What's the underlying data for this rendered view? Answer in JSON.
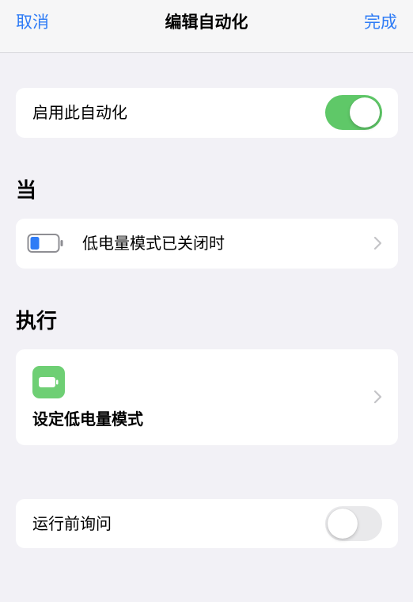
{
  "navbar": {
    "cancel_label": "取消",
    "title": "编辑自动化",
    "done_label": "完成"
  },
  "enable_automation": {
    "label": "启用此自动化",
    "toggle_on": true
  },
  "when_section": {
    "title": "当",
    "trigger_label": "低电量模式已关闭时",
    "trigger_icon": "battery-low-icon"
  },
  "do_section": {
    "title": "执行",
    "action_label": "设定低电量模式",
    "action_icon": "battery-icon"
  },
  "ask_before_running": {
    "label": "运行前询问",
    "toggle_on": false
  },
  "colors": {
    "accent": "#2F7CF6",
    "toggle_on": "#5FC868",
    "action_tile": "#6ECF74",
    "background": "#F2F1F6"
  }
}
